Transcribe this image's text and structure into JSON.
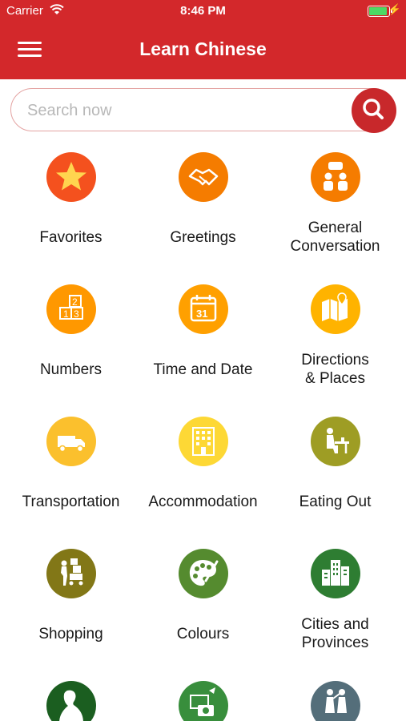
{
  "status": {
    "carrier": "Carrier",
    "time": "8:46 PM"
  },
  "header": {
    "title": "Learn Chinese",
    "menu_icon": "hamburger-menu-icon"
  },
  "search": {
    "placeholder": "Search now",
    "button_icon": "search-icon"
  },
  "categories": [
    {
      "label": "Favorites",
      "icon": "star-icon",
      "color": "#f4511e"
    },
    {
      "label": "Greetings",
      "icon": "handshake-icon",
      "color": "#f57c00"
    },
    {
      "label": "General\nConversation",
      "icon": "conversation-icon",
      "color": "#f57c00"
    },
    {
      "label": "Numbers",
      "icon": "number-blocks-icon",
      "color": "#ff9800"
    },
    {
      "label": "Time and Date",
      "icon": "calendar-icon",
      "color": "#ffa000"
    },
    {
      "label": "Directions\n& Places",
      "icon": "map-icon",
      "color": "#ffb300"
    },
    {
      "label": "Transportation",
      "icon": "truck-icon",
      "color": "#fbc02d"
    },
    {
      "label": "Accommodation",
      "icon": "hotel-icon",
      "color": "#fdd835"
    },
    {
      "label": "Eating Out",
      "icon": "dining-icon",
      "color": "#9e9d24"
    },
    {
      "label": "Shopping",
      "icon": "shopping-cart-icon",
      "color": "#827717"
    },
    {
      "label": "Colours",
      "icon": "palette-icon",
      "color": "#558b2f"
    },
    {
      "label": "Cities and\nProvinces",
      "icon": "city-buildings-icon",
      "color": "#2e7d32"
    },
    {
      "label": "",
      "icon": "person-silhouette-icon",
      "color": "#1b5e20"
    },
    {
      "label": "",
      "icon": "travel-camera-icon",
      "color": "#388e3c"
    },
    {
      "label": "",
      "icon": "family-icon",
      "color": "#546e7a"
    }
  ]
}
